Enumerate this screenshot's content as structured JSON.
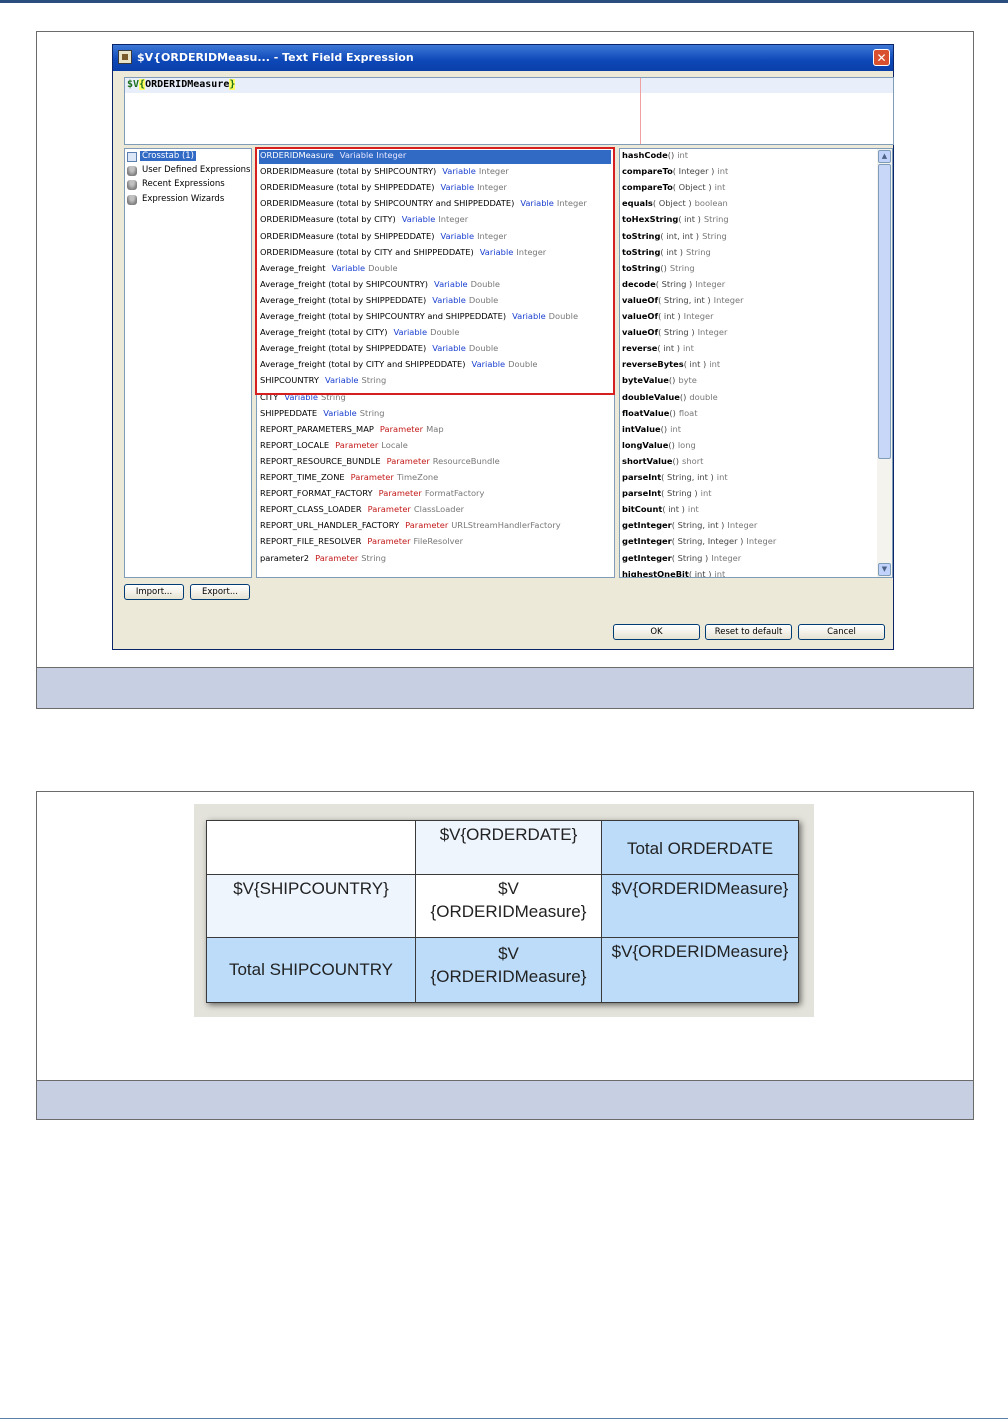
{
  "dialog": {
    "title": "$V{ORDERIDMeasu... - Text Field Expression",
    "close_glyph": "✕",
    "expression": {
      "prefix": "$V",
      "open": "{",
      "name": "ORDERIDMeasure",
      "close": "}"
    },
    "categories": [
      {
        "label": "Crosstab (1)",
        "icon": "grid-icon"
      },
      {
        "label": "User Defined Expressions",
        "icon": "database-icon"
      },
      {
        "label": "Recent Expressions",
        "icon": "database-icon"
      },
      {
        "label": "Expression Wizards",
        "icon": "database-icon"
      }
    ],
    "objects": [
      {
        "name": "ORDERIDMeasure",
        "kind": "Variable",
        "type": "Integer",
        "kind_style": "var"
      },
      {
        "name": "ORDERIDMeasure (total by SHIPCOUNTRY)",
        "kind": "Variable",
        "type": "Integer",
        "kind_style": "var"
      },
      {
        "name": "ORDERIDMeasure (total by SHIPPEDDATE)",
        "kind": "Variable",
        "type": "Integer",
        "kind_style": "var"
      },
      {
        "name": "ORDERIDMeasure (total by SHIPCOUNTRY and SHIPPEDDATE)",
        "kind": "Variable",
        "type": "Integer",
        "kind_style": "var"
      },
      {
        "name": "ORDERIDMeasure (total by CITY)",
        "kind": "Variable",
        "type": "Integer",
        "kind_style": "var"
      },
      {
        "name": "ORDERIDMeasure (total by SHIPPEDDATE)",
        "kind": "Variable",
        "type": "Integer",
        "kind_style": "var"
      },
      {
        "name": "ORDERIDMeasure (total by CITY and SHIPPEDDATE)",
        "kind": "Variable",
        "type": "Integer",
        "kind_style": "var"
      },
      {
        "name": "Average_freight",
        "kind": "Variable",
        "type": "Double",
        "kind_style": "var"
      },
      {
        "name": "Average_freight (total by SHIPCOUNTRY)",
        "kind": "Variable",
        "type": "Double",
        "kind_style": "var"
      },
      {
        "name": "Average_freight (total by SHIPPEDDATE)",
        "kind": "Variable",
        "type": "Double",
        "kind_style": "var"
      },
      {
        "name": "Average_freight (total by SHIPCOUNTRY and SHIPPEDDATE)",
        "kind": "Variable",
        "type": "Double",
        "kind_style": "var"
      },
      {
        "name": "Average_freight (total by CITY)",
        "kind": "Variable",
        "type": "Double",
        "kind_style": "var"
      },
      {
        "name": "Average_freight (total by SHIPPEDDATE)",
        "kind": "Variable",
        "type": "Double",
        "kind_style": "var"
      },
      {
        "name": "Average_freight (total by CITY and SHIPPEDDATE)",
        "kind": "Variable",
        "type": "Double",
        "kind_style": "var"
      },
      {
        "name": "SHIPCOUNTRY",
        "kind": "Variable",
        "type": "String",
        "kind_style": "var"
      },
      {
        "name": "CITY",
        "kind": "Variable",
        "type": "String",
        "kind_style": "var"
      },
      {
        "name": "SHIPPEDDATE",
        "kind": "Variable",
        "type": "String",
        "kind_style": "var"
      },
      {
        "name": "REPORT_PARAMETERS_MAP",
        "kind": "Parameter",
        "type": "Map",
        "kind_style": "par"
      },
      {
        "name": "REPORT_LOCALE",
        "kind": "Parameter",
        "type": "Locale",
        "kind_style": "par"
      },
      {
        "name": "REPORT_RESOURCE_BUNDLE",
        "kind": "Parameter",
        "type": "ResourceBundle",
        "kind_style": "par"
      },
      {
        "name": "REPORT_TIME_ZONE",
        "kind": "Parameter",
        "type": "TimeZone",
        "kind_style": "par"
      },
      {
        "name": "REPORT_FORMAT_FACTORY",
        "kind": "Parameter",
        "type": "FormatFactory",
        "kind_style": "par"
      },
      {
        "name": "REPORT_CLASS_LOADER",
        "kind": "Parameter",
        "type": "ClassLoader",
        "kind_style": "par"
      },
      {
        "name": "REPORT_URL_HANDLER_FACTORY",
        "kind": "Parameter",
        "type": "URLStreamHandlerFactory",
        "kind_style": "par"
      },
      {
        "name": "REPORT_FILE_RESOLVER",
        "kind": "Parameter",
        "type": "FileResolver",
        "kind_style": "par"
      },
      {
        "name": "parameter2",
        "kind": "Parameter",
        "type": "String",
        "kind_style": "par"
      }
    ],
    "methods": [
      {
        "name": "hashCode",
        "args": "()",
        "ret": "int"
      },
      {
        "name": "compareTo",
        "args": "( Integer )",
        "ret": "int"
      },
      {
        "name": "compareTo",
        "args": "( Object )",
        "ret": "int"
      },
      {
        "name": "equals",
        "args": "( Object )",
        "ret": "boolean"
      },
      {
        "name": "toHexString",
        "args": "( int )",
        "ret": "String"
      },
      {
        "name": "toString",
        "args": "( int, int )",
        "ret": "String"
      },
      {
        "name": "toString",
        "args": "( int )",
        "ret": "String"
      },
      {
        "name": "toString",
        "args": "()",
        "ret": "String"
      },
      {
        "name": "decode",
        "args": "( String )",
        "ret": "Integer"
      },
      {
        "name": "valueOf",
        "args": "( String, int )",
        "ret": "Integer"
      },
      {
        "name": "valueOf",
        "args": "( int )",
        "ret": "Integer"
      },
      {
        "name": "valueOf",
        "args": "( String )",
        "ret": "Integer"
      },
      {
        "name": "reverse",
        "args": "( int )",
        "ret": "int"
      },
      {
        "name": "reverseBytes",
        "args": "( int )",
        "ret": "int"
      },
      {
        "name": "byteValue",
        "args": "()",
        "ret": "byte"
      },
      {
        "name": "doubleValue",
        "args": "()",
        "ret": "double"
      },
      {
        "name": "floatValue",
        "args": "()",
        "ret": "float"
      },
      {
        "name": "intValue",
        "args": "()",
        "ret": "int"
      },
      {
        "name": "longValue",
        "args": "()",
        "ret": "long"
      },
      {
        "name": "shortValue",
        "args": "()",
        "ret": "short"
      },
      {
        "name": "parseInt",
        "args": "( String, int )",
        "ret": "int"
      },
      {
        "name": "parseInt",
        "args": "( String )",
        "ret": "int"
      },
      {
        "name": "bitCount",
        "args": "( int )",
        "ret": "int"
      },
      {
        "name": "getInteger",
        "args": "( String, int )",
        "ret": "Integer"
      },
      {
        "name": "getInteger",
        "args": "( String, Integer )",
        "ret": "Integer"
      },
      {
        "name": "getInteger",
        "args": "( String )",
        "ret": "Integer"
      },
      {
        "name": "highestOneBit",
        "args": "( int )",
        "ret": "int"
      }
    ],
    "buttons": {
      "import": "Import...",
      "export": "Export...",
      "ok": "OK",
      "reset": "Reset to default",
      "cancel": "Cancel"
    }
  },
  "crosstab": {
    "col_header": "$V{ORDERDATE}",
    "col_total": "Total ORDERDATE",
    "row_header": "$V{SHIPCOUNTRY}",
    "row_total": "Total SHIPCOUNTRY",
    "measure_wrapped_1": "$V",
    "measure_wrapped_2": "{ORDERIDMeasure}",
    "measure": "$V{ORDERIDMeasure}",
    "colors": {
      "header": "#eef5fd",
      "total": "#bcdcfa",
      "body": "#ffffff"
    }
  }
}
